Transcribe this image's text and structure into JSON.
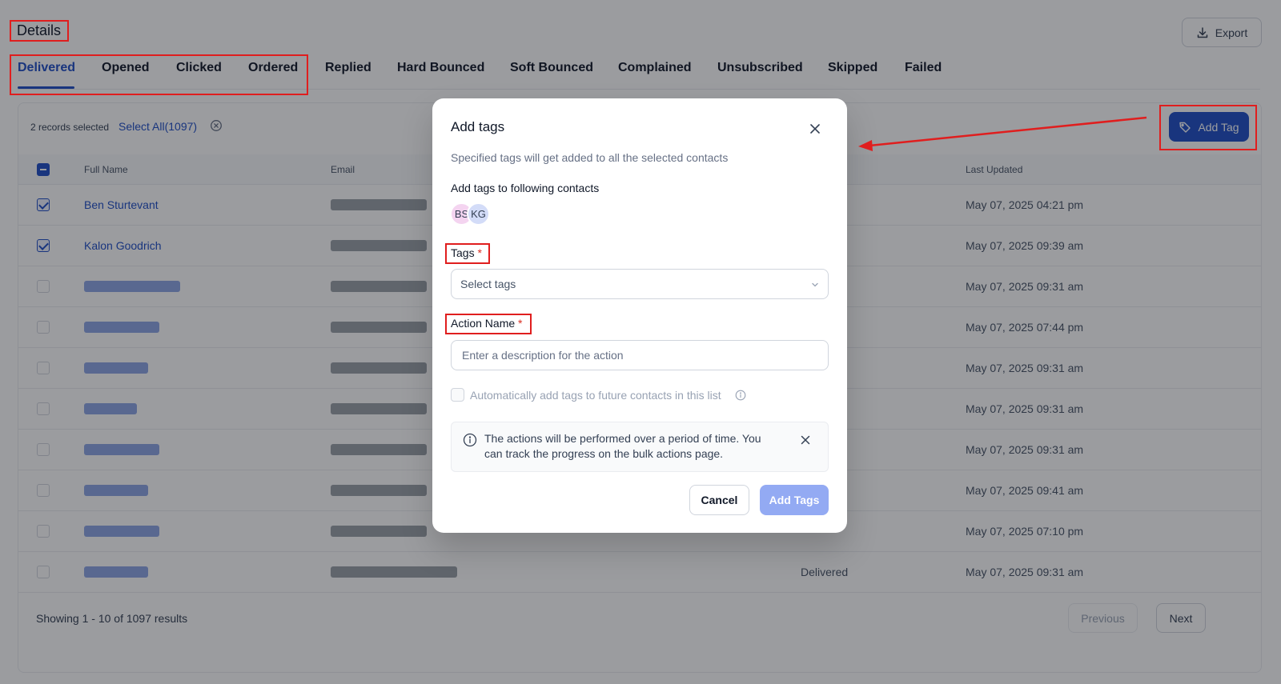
{
  "header": {
    "title": "Details",
    "export_label": "Export"
  },
  "tabs": [
    {
      "label": "Delivered",
      "active": true
    },
    {
      "label": "Opened"
    },
    {
      "label": "Clicked"
    },
    {
      "label": "Ordered"
    },
    {
      "label": "Replied"
    },
    {
      "label": "Hard Bounced"
    },
    {
      "label": "Soft Bounced"
    },
    {
      "label": "Complained"
    },
    {
      "label": "Unsubscribed"
    },
    {
      "label": "Skipped"
    },
    {
      "label": "Failed"
    }
  ],
  "selection": {
    "records_selected": "2 records selected",
    "select_all": "Select All(1097)",
    "add_tag_label": "Add Tag"
  },
  "table": {
    "columns": {
      "full_name": "Full Name",
      "email": "Email",
      "last_updated": "Last Updated"
    },
    "rows": [
      {
        "name": "Ben Sturtevant",
        "checked": true,
        "status": "",
        "last_updated": "May 07, 2025 04:21 pm"
      },
      {
        "name": "Kalon Goodrich",
        "checked": true,
        "status": "",
        "last_updated": "May 07, 2025 09:39 am"
      },
      {
        "name": "",
        "checked": false,
        "status": "",
        "last_updated": "May 07, 2025 09:31 am"
      },
      {
        "name": "",
        "checked": false,
        "status": "",
        "last_updated": "May 07, 2025 07:44 pm"
      },
      {
        "name": "",
        "checked": false,
        "status": "",
        "last_updated": "May 07, 2025 09:31 am"
      },
      {
        "name": "",
        "checked": false,
        "status": "",
        "last_updated": "May 07, 2025 09:31 am"
      },
      {
        "name": "",
        "checked": false,
        "status": "",
        "last_updated": "May 07, 2025 09:31 am"
      },
      {
        "name": "",
        "checked": false,
        "status": "",
        "last_updated": "May 07, 2025 09:41 am"
      },
      {
        "name": "",
        "checked": false,
        "status": "",
        "last_updated": "May 07, 2025 07:10 pm"
      },
      {
        "name": "",
        "checked": false,
        "status": "Delivered",
        "last_updated": "May 07, 2025 09:31 am"
      }
    ]
  },
  "pagination": {
    "summary": "Showing 1 - 10 of 1097 results",
    "previous": "Previous",
    "next": "Next"
  },
  "modal": {
    "title": "Add tags",
    "subtitle": "Specified tags will get added to all the selected contacts",
    "contacts_label": "Add tags to following contacts",
    "avatars": [
      "BS",
      "KG"
    ],
    "tags_label": "Tags",
    "required_mark": "*",
    "tags_placeholder": "Select tags",
    "action_label": "Action Name",
    "action_placeholder": "Enter a description for the action",
    "auto_label": "Automatically add tags to future contacts in this list",
    "notice": "The actions will be performed over a period of time. You can track the progress on the bulk actions page.",
    "cancel": "Cancel",
    "submit": "Add Tags"
  },
  "colors": {
    "primary": "#1f4fc7",
    "annotation": "#e01e1e"
  }
}
